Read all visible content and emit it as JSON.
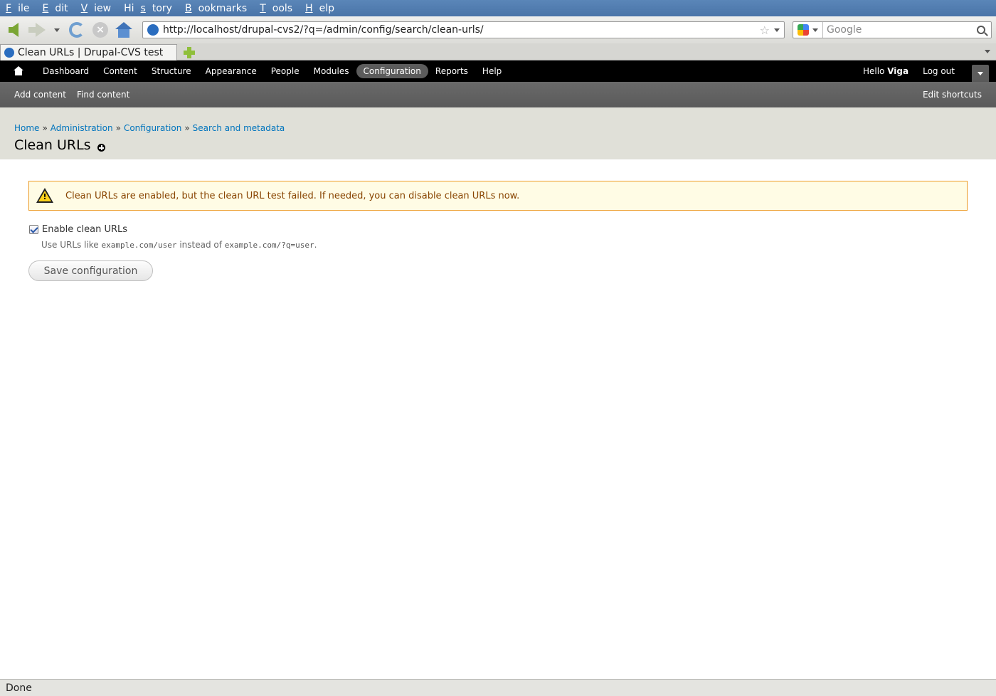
{
  "browser": {
    "menu": [
      {
        "label": "File",
        "accel": "F",
        "rest": "ile"
      },
      {
        "label": "Edit",
        "accel": "E",
        "rest": "dit"
      },
      {
        "label": "View",
        "accel": "V",
        "rest": "iew"
      },
      {
        "label": "History",
        "accel": "",
        "pre": "Hi",
        "accel2": "s",
        "rest": "tory"
      },
      {
        "label": "Bookmarks",
        "accel": "B",
        "rest": "ookmarks"
      },
      {
        "label": "Tools",
        "accel": "T",
        "rest": "ools"
      },
      {
        "label": "Help",
        "accel": "H",
        "rest": "elp"
      }
    ],
    "url": "http://localhost/drupal-cvs2/?q=/admin/config/search/clean-urls/",
    "search_placeholder": "Google",
    "tab_title": "Clean URLs | Drupal-CVS test",
    "status": "Done"
  },
  "toolbar": {
    "items": [
      "Dashboard",
      "Content",
      "Structure",
      "Appearance",
      "People",
      "Modules",
      "Configuration",
      "Reports",
      "Help"
    ],
    "active": "Configuration",
    "hello_prefix": "Hello",
    "user": "Viga",
    "logout": "Log out"
  },
  "shortcuts": {
    "items": [
      "Add content",
      "Find content"
    ],
    "edit": "Edit shortcuts"
  },
  "header": {
    "breadcrumb": [
      "Home",
      "Administration",
      "Configuration",
      "Search and metadata"
    ],
    "breadcrumb_sep": "»",
    "title": "Clean URLs"
  },
  "content": {
    "warning": "Clean URLs are enabled, but the clean URL test failed. If needed, you can disable clean URLs now.",
    "checkbox_label": "Enable clean URLs",
    "checkbox_checked": true,
    "description_prefix": "Use URLs like",
    "description_code1": "example.com/user",
    "description_mid": "instead of",
    "description_code2": "example.com/?q=user",
    "description_suffix": ".",
    "save_button": "Save configuration"
  },
  "colors": {
    "link": "#0074bd",
    "warning_bg": "#fffce5",
    "warning_border": "#ed9c28",
    "warning_text": "#884400"
  }
}
